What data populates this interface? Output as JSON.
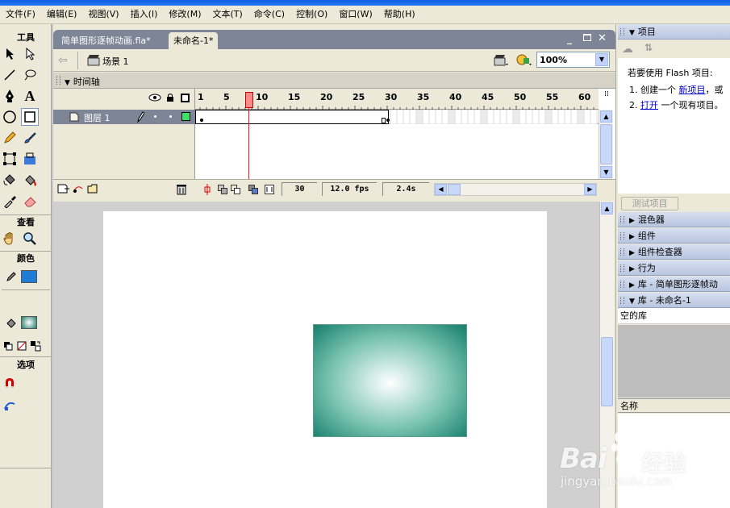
{
  "menu": [
    "文件(F)",
    "编辑(E)",
    "视图(V)",
    "插入(I)",
    "修改(M)",
    "文本(T)",
    "命令(C)",
    "控制(O)",
    "窗口(W)",
    "帮助(H)"
  ],
  "toolbox": {
    "title": "工具",
    "view_label": "查看",
    "color_label": "颜色",
    "options_label": "选项"
  },
  "document": {
    "tabs": [
      "简单图形逐帧动画.fla*",
      "未命名-1*"
    ],
    "active_tab": 1,
    "scene": "场景 1",
    "zoom": "100%"
  },
  "timeline": {
    "title": "时间轴",
    "layer_name": "图层 1",
    "frame_numbers": [
      "1",
      "5",
      "10",
      "15",
      "20",
      "25",
      "30",
      "35",
      "40",
      "45",
      "50",
      "55",
      "60"
    ],
    "current_frame": "30",
    "fps": "12.0 fps",
    "elapsed": "2.4s"
  },
  "right_panel": {
    "project_title": "项目",
    "project_intro": "若要使用 Flash 项目:",
    "step1_prefix": "1. 创建一个",
    "step1_link": "新项目",
    "step1_suffix": "，或",
    "step2_prefix": "2.",
    "step2_link": "打开",
    "step2_suffix": "一个现有项目。",
    "test_button": "测试项目",
    "panels": [
      "混色器",
      "组件",
      "组件检查器",
      "行为",
      "库 - 简单图形逐帧动",
      "库 - 未命名-1"
    ],
    "library_empty": "空的库",
    "name_column": "名称"
  },
  "watermark": {
    "brand": "Bai",
    "brand_suffix": "经验",
    "url": "jingyan.baidu.com"
  },
  "colors": {
    "stroke_color": "#000000",
    "fill_color": "#1e7bd6",
    "gradient_center": "#ffffff",
    "gradient_edge": "#1e7d6a"
  }
}
